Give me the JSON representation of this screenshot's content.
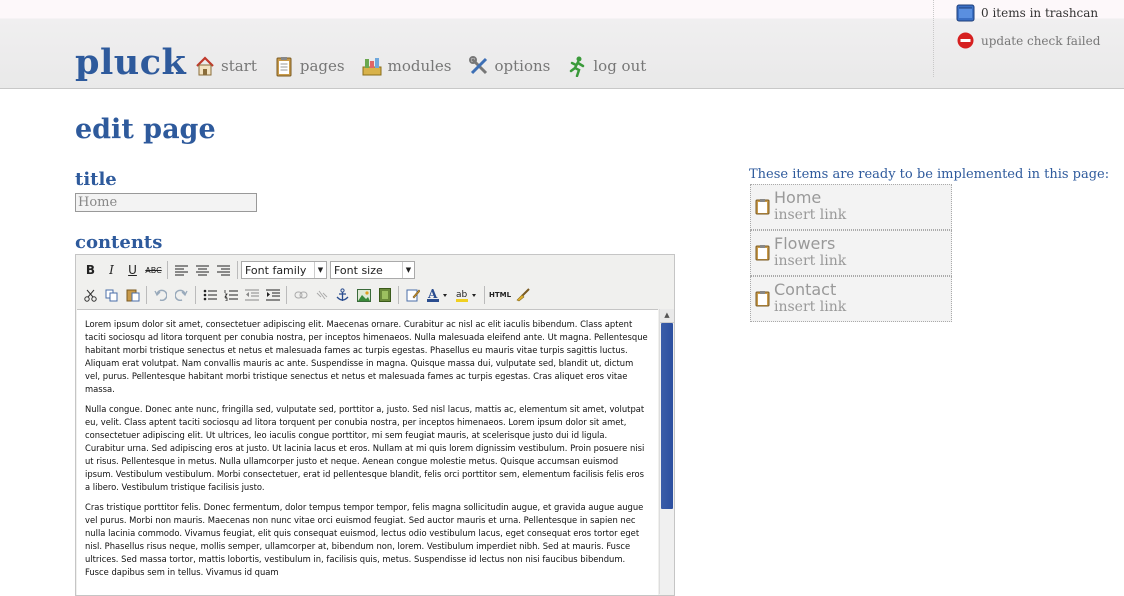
{
  "header": {
    "logo": "pluck",
    "nav": [
      {
        "label": "start",
        "icon": "home-icon"
      },
      {
        "label": "pages",
        "icon": "clipboard-icon"
      },
      {
        "label": "modules",
        "icon": "modules-icon"
      },
      {
        "label": "options",
        "icon": "tools-icon"
      },
      {
        "label": "log out",
        "icon": "running-man-icon"
      }
    ],
    "trash_status": "0 items in trashcan",
    "update_status": "update check failed"
  },
  "page": {
    "heading": "edit page",
    "title_label": "title",
    "title_value": "Home",
    "contents_label": "contents"
  },
  "editor": {
    "font_family": "Font family",
    "font_size": "Font size",
    "html_button": "HTML",
    "paragraphs": [
      "Lorem ipsum dolor sit amet, consectetuer adipiscing elit. Maecenas ornare. Curabitur ac nisl ac elit iaculis bibendum. Class aptent taciti sociosqu ad litora torquent per conubia nostra, per inceptos himenaeos. Nulla malesuada eleifend ante. Ut magna. Pellentesque habitant morbi tristique senectus et netus et malesuada fames ac turpis egestas. Phasellus eu mauris vitae turpis sagittis luctus. Aliquam erat volutpat. Nam convallis mauris ac ante. Suspendisse in magna. Quisque massa dui, vulputate sed, blandit ut, dictum vel, purus. Pellentesque habitant morbi tristique senectus et netus et malesuada fames ac turpis egestas. Cras aliquet eros vitae massa.",
      "Nulla congue. Donec ante nunc, fringilla sed, vulputate sed, porttitor a, justo. Sed nisl lacus, mattis ac, elementum sit amet, volutpat eu, velit. Class aptent taciti sociosqu ad litora torquent per conubia nostra, per inceptos himenaeos. Lorem ipsum dolor sit amet, consectetuer adipiscing elit. Ut ultrices, leo iaculis congue porttitor, mi sem feugiat mauris, at scelerisque justo dui id ligula. Curabitur urna. Sed adipiscing eros at justo. Ut lacinia lacus et eros. Nullam at mi quis lorem dignissim vestibulum. Proin posuere nisi ut risus. Pellentesque in metus. Nulla ullamcorper justo et neque. Aenean congue molestie metus. Quisque accumsan euismod ipsum. Vestibulum vestibulum. Morbi consectetuer, erat id pellentesque blandit, felis orci porttitor sem, elementum facilisis felis eros a libero. Vestibulum tristique facilisis justo.",
      "Cras tristique porttitor felis. Donec fermentum, dolor tempus tempor tempor, felis magna sollicitudin augue, et gravida augue augue vel purus. Morbi non mauris. Maecenas non nunc vitae orci euismod feugiat. Sed auctor mauris et urna. Pellentesque in sapien nec nulla lacinia commodo. Vivamus feugiat, elit quis consequat euismod, lectus odio vestibulum lacus, eget consequat eros tortor eget nisl. Phasellus risus neque, mollis semper, ullamcorper at, bibendum non, lorem. Vestibulum imperdiet nibh. Sed at mauris. Fusce ultrices. Sed massa tortor, mattis lobortis, vestibulum in, facilisis quis, metus. Suspendisse id lectus non nisi faucibus bibendum. Fusce dapibus sem in tellus. Vivamus id quam"
    ]
  },
  "sidebar": {
    "label": "These items are ready to be implemented in this page:",
    "items": [
      {
        "name": "Home",
        "link": "insert link"
      },
      {
        "name": "Flowers",
        "link": "insert link"
      },
      {
        "name": "Contact",
        "link": "insert link"
      }
    ]
  },
  "colors": {
    "accent": "#2e5a9c",
    "scrollbar": "#2c4fa0"
  }
}
